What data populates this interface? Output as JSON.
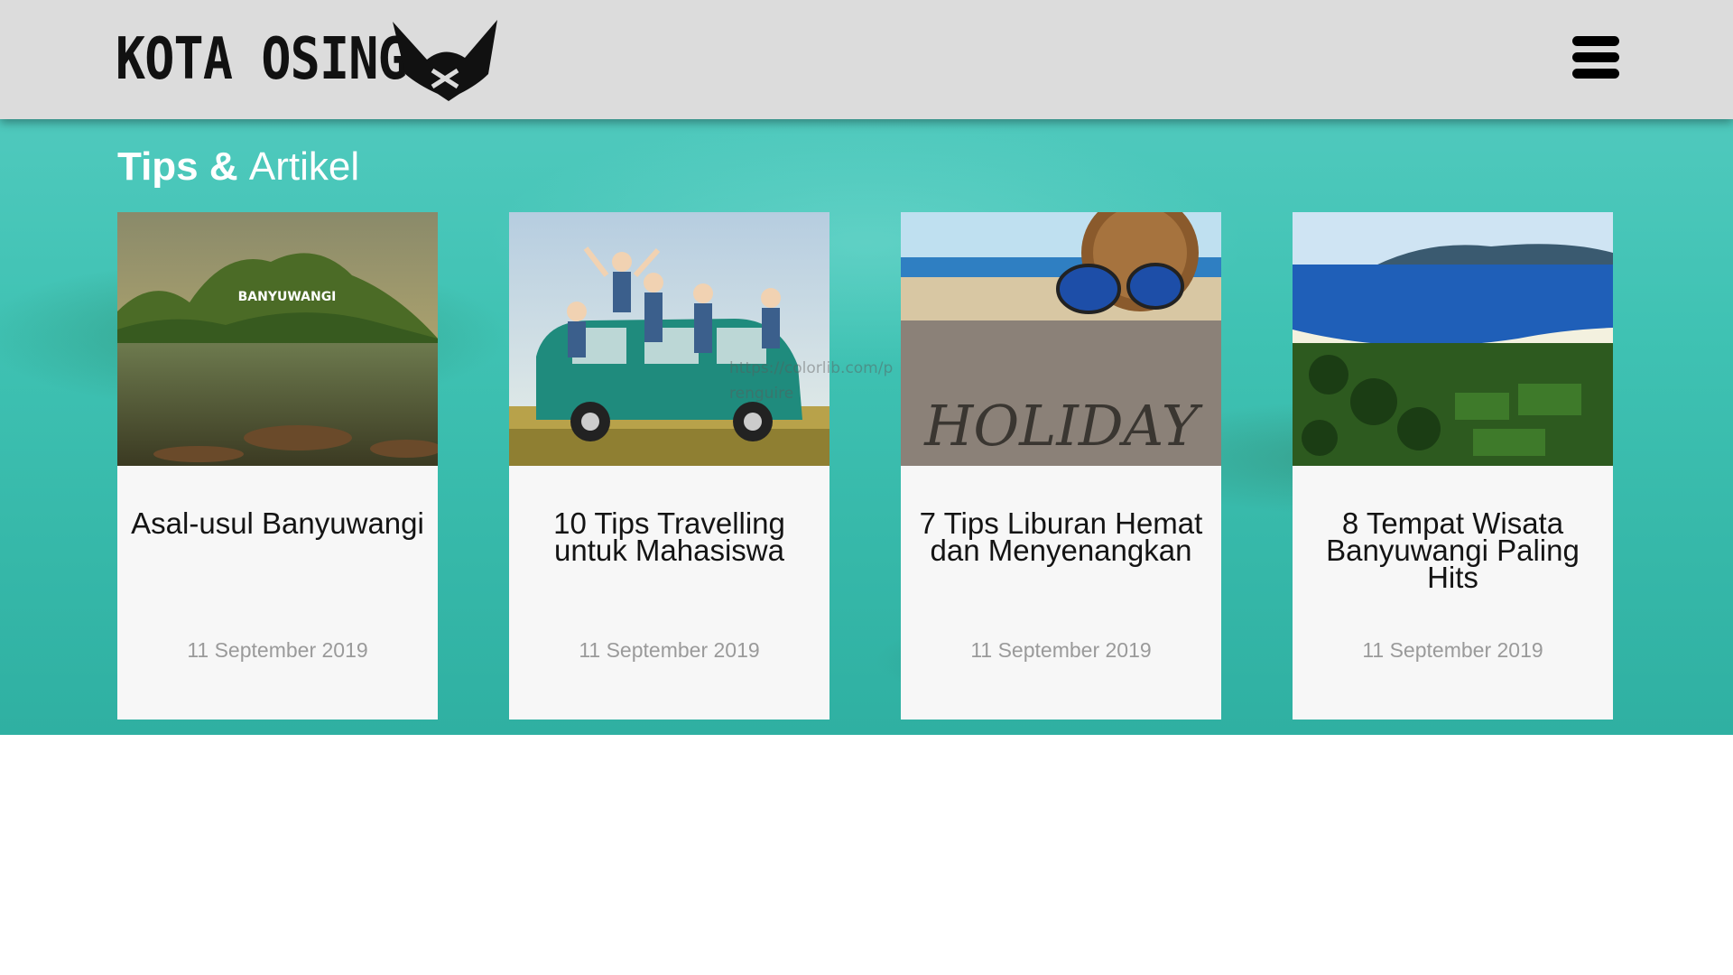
{
  "header": {
    "logo_text": "KOTA OSING",
    "logo_mark_icon": "horned-helmet-icon",
    "menu_icon": "hamburger-menu-icon"
  },
  "section": {
    "title_bold": "Tips &",
    "title_light": "Artikel"
  },
  "watermark": {
    "line1": "https://colorlib.com/p",
    "line2": "renguire"
  },
  "cards": [
    {
      "title": "Asal-usul Banyuwangi",
      "date": "11 September 2019",
      "image_label": "BANYUWANGI",
      "image": "hill-sign-photo"
    },
    {
      "title": "10 Tips Travelling untuk Mahasiswa",
      "date": "11 September 2019",
      "image": "friends-van-photo"
    },
    {
      "title": "7 Tips Liburan Hemat dan Menyenangkan",
      "date": "11 September 2019",
      "image_label": "HOLIDAY",
      "image": "beach-holiday-photo"
    },
    {
      "title": "8 Tempat Wisata Banyuwangi Paling Hits",
      "date": "11 September 2019",
      "image": "coastline-photo"
    }
  ],
  "colors": {
    "header_bg": "#dcdcdc",
    "hero_teal": "#3fc2b3",
    "card_bg": "#f7f7f7",
    "date_gray": "#9a9a9a"
  }
}
